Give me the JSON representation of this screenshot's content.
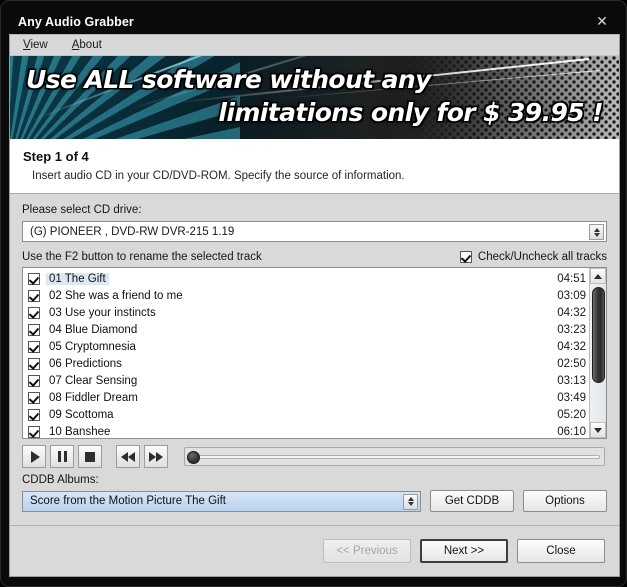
{
  "window": {
    "title": "Any Audio Grabber",
    "close_icon": "close-icon"
  },
  "menu": {
    "items": [
      {
        "label": "View",
        "accel": "V",
        "rest": "iew"
      },
      {
        "label": "About",
        "accel": "A",
        "rest": "bout"
      }
    ]
  },
  "banner": {
    "line1": "Use ALL software without any",
    "line2": "limitations only for $ 39.95 !"
  },
  "step": {
    "title": "Step 1 of 4",
    "subtitle": "Insert audio CD in your CD/DVD-ROM. Specify the source of information."
  },
  "drive": {
    "label": "Please select CD drive:",
    "value": "(G) PIONEER , DVD-RW  DVR-215  1.19"
  },
  "tracks_header": {
    "hint": "Use the F2 button to rename the selected track",
    "check_all_label": "Check/Uncheck all tracks",
    "check_all_checked": true
  },
  "tracks": [
    {
      "num": "01",
      "title": "The Gift",
      "duration": "04:51",
      "checked": true,
      "selected": true
    },
    {
      "num": "02",
      "title": "She was a friend to me",
      "duration": "03:09",
      "checked": true,
      "selected": false
    },
    {
      "num": "03",
      "title": "Use your instincts",
      "duration": "04:32",
      "checked": true,
      "selected": false
    },
    {
      "num": "04",
      "title": "Blue Diamond",
      "duration": "03:23",
      "checked": true,
      "selected": false
    },
    {
      "num": "05",
      "title": "Cryptomnesia",
      "duration": "04:32",
      "checked": true,
      "selected": false
    },
    {
      "num": "06",
      "title": "Predictions",
      "duration": "02:50",
      "checked": true,
      "selected": false
    },
    {
      "num": "07",
      "title": "Clear Sensing",
      "duration": "03:13",
      "checked": true,
      "selected": false
    },
    {
      "num": "08",
      "title": "Fiddler Dream",
      "duration": "03:49",
      "checked": true,
      "selected": false
    },
    {
      "num": "09",
      "title": "Scottoma",
      "duration": "05:20",
      "checked": true,
      "selected": false
    },
    {
      "num": "10",
      "title": "Banshee",
      "duration": "06:10",
      "checked": true,
      "selected": false
    }
  ],
  "transport": {
    "play": "play-icon",
    "pause": "pause-icon",
    "stop": "stop-icon",
    "rewind": "rewind-icon",
    "forward": "fast-forward-icon",
    "position_percent": 0
  },
  "cddb": {
    "label": "CDDB Albums:",
    "value": "Score from the Motion Picture The Gift",
    "get_button": "Get CDDB",
    "options_button": "Options"
  },
  "footer": {
    "previous": "<< Previous",
    "previous_enabled": false,
    "next": "Next >>",
    "close": "Close"
  },
  "colors": {
    "selection_blue": "#dce9f5",
    "combo_blue": "#b9d3ee",
    "window_chrome": "#0a0a0a",
    "body_grey": "#d9d9d9"
  }
}
